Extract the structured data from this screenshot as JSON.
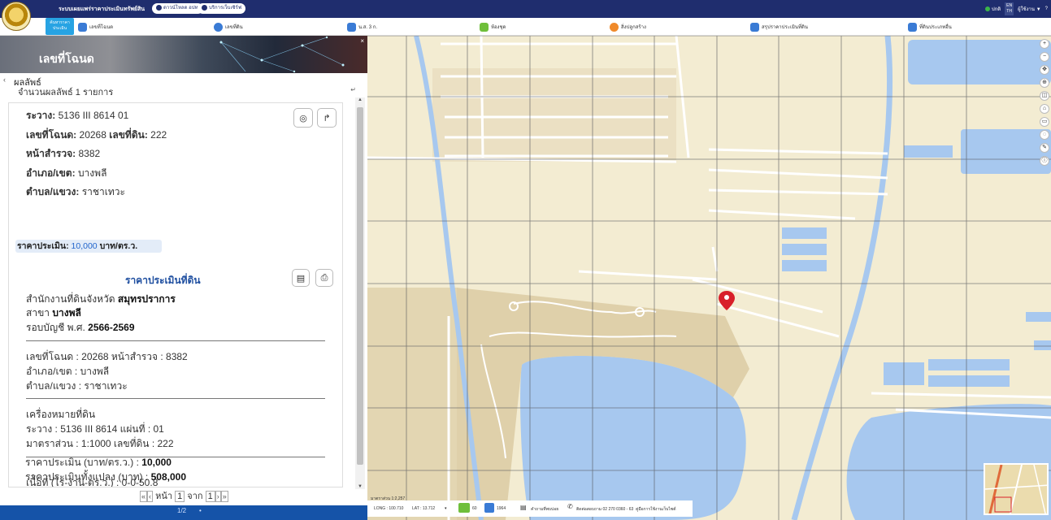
{
  "topbar": {
    "system_title": "ระบบเผยแพร่ราคาประเมินทรัพย์สิน",
    "pill1": "ดาวน์โหลด อปท.",
    "pill2": "บริการเว็บเซิร์ฟ",
    "status": "ปกติ",
    "lang_top": "EN",
    "lang_bottom": "TH",
    "user": "ผู้ใช้งาน",
    "help": "?"
  },
  "menubar": {
    "home_label": "ค้นหาราคาประเมิน",
    "items": [
      "เลขที่โฉนด",
      "เลขที่ดิน",
      "น.ส. 3 ก.",
      "ห้องชุด",
      "สิ่งปลูกสร้าง",
      "สรุปราคาประเมินที่ดิน",
      "ที่ดินประเภทอื่น"
    ]
  },
  "panel": {
    "title": "เลขที่โฉนด",
    "close": "×",
    "results_label": "ผลลัพธ์",
    "results_count": "จำนวนผลลัพธ์ 1 รายการ",
    "summary": {
      "ra_wang": {
        "label": "ระวาง:",
        "value": "5136 III 8614 01"
      },
      "deed": {
        "label": "เลขที่โฉนด:",
        "value": "20268",
        "land_label": "เลขที่ดิน:",
        "land_value": "222"
      },
      "survey": {
        "label": "หน้าสำรวจ:",
        "value": "8382"
      },
      "amphoe": {
        "label": "อำเภอ/เขต:",
        "value": "บางพลี"
      },
      "tambon": {
        "label": "ตำบล/แขวง:",
        "value": "ราชาเทวะ"
      },
      "price": {
        "label": "ราคาประเมิน:",
        "value": "10,000",
        "unit": "บาท/ตร.ว."
      }
    },
    "section_title": "ราคาประเมินที่ดิน",
    "detail": {
      "office_prefix": "สำนักงานที่ดินจังหวัด",
      "office_province": "สมุทรปราการ",
      "branch_prefix": "สาขา",
      "branch": "บางพลี",
      "cycle_prefix": "รอบบัญชี พ.ศ.",
      "cycle": "2566-2569",
      "deed_line": "เลขที่โฉนด : 20268 หน้าสำรวจ : 8382",
      "amphoe_line": "อำเภอ/เขต : บางพลี",
      "tambon_line": "ตำบล/แขวง : ราชาเทวะ",
      "landmark_title": "เครื่องหมายที่ดิน",
      "ra_wang_line": "ระวาง : 5136 III 8614 แผ่นที่ : 01",
      "scale_line": "มาตราส่วน : 1:1000 เลขที่ดิน : 222",
      "area_line": "เนื้อที่ (ไร่-งาน-ตร.ว.) : 0-0-50.8",
      "price_prefix": "ราคาประเมิน (บาท/ตร.ว.) :",
      "price_value": "10,000",
      "total_prefix": "ราคาประเมินทั้งแปลง (บาท) :",
      "total_value": "508,000"
    },
    "pager": {
      "first": "«",
      "prev": "‹",
      "page_label": "หน้า",
      "page": "1",
      "of_label": "จาก",
      "total": "1",
      "next": "›",
      "last": "»"
    },
    "footer_page": "1/2"
  },
  "map": {
    "scale": "มาตราส่วน 1:2,257",
    "long": "LONG : 100.710",
    "lat": "LAT : 13.712",
    "count1": "60",
    "count2": "1964",
    "text1": "คำถามที่พบบ่อย",
    "contact": "ติดต่อสอบถาม 02 270 0360 - 63",
    "manual": "คู่มือการใช้งานเว็บไซต์",
    "colors": {
      "land": "#f3ecd2",
      "water": "#a7c8ef",
      "accent": "#1553a8",
      "marker": "#d8202a"
    }
  }
}
